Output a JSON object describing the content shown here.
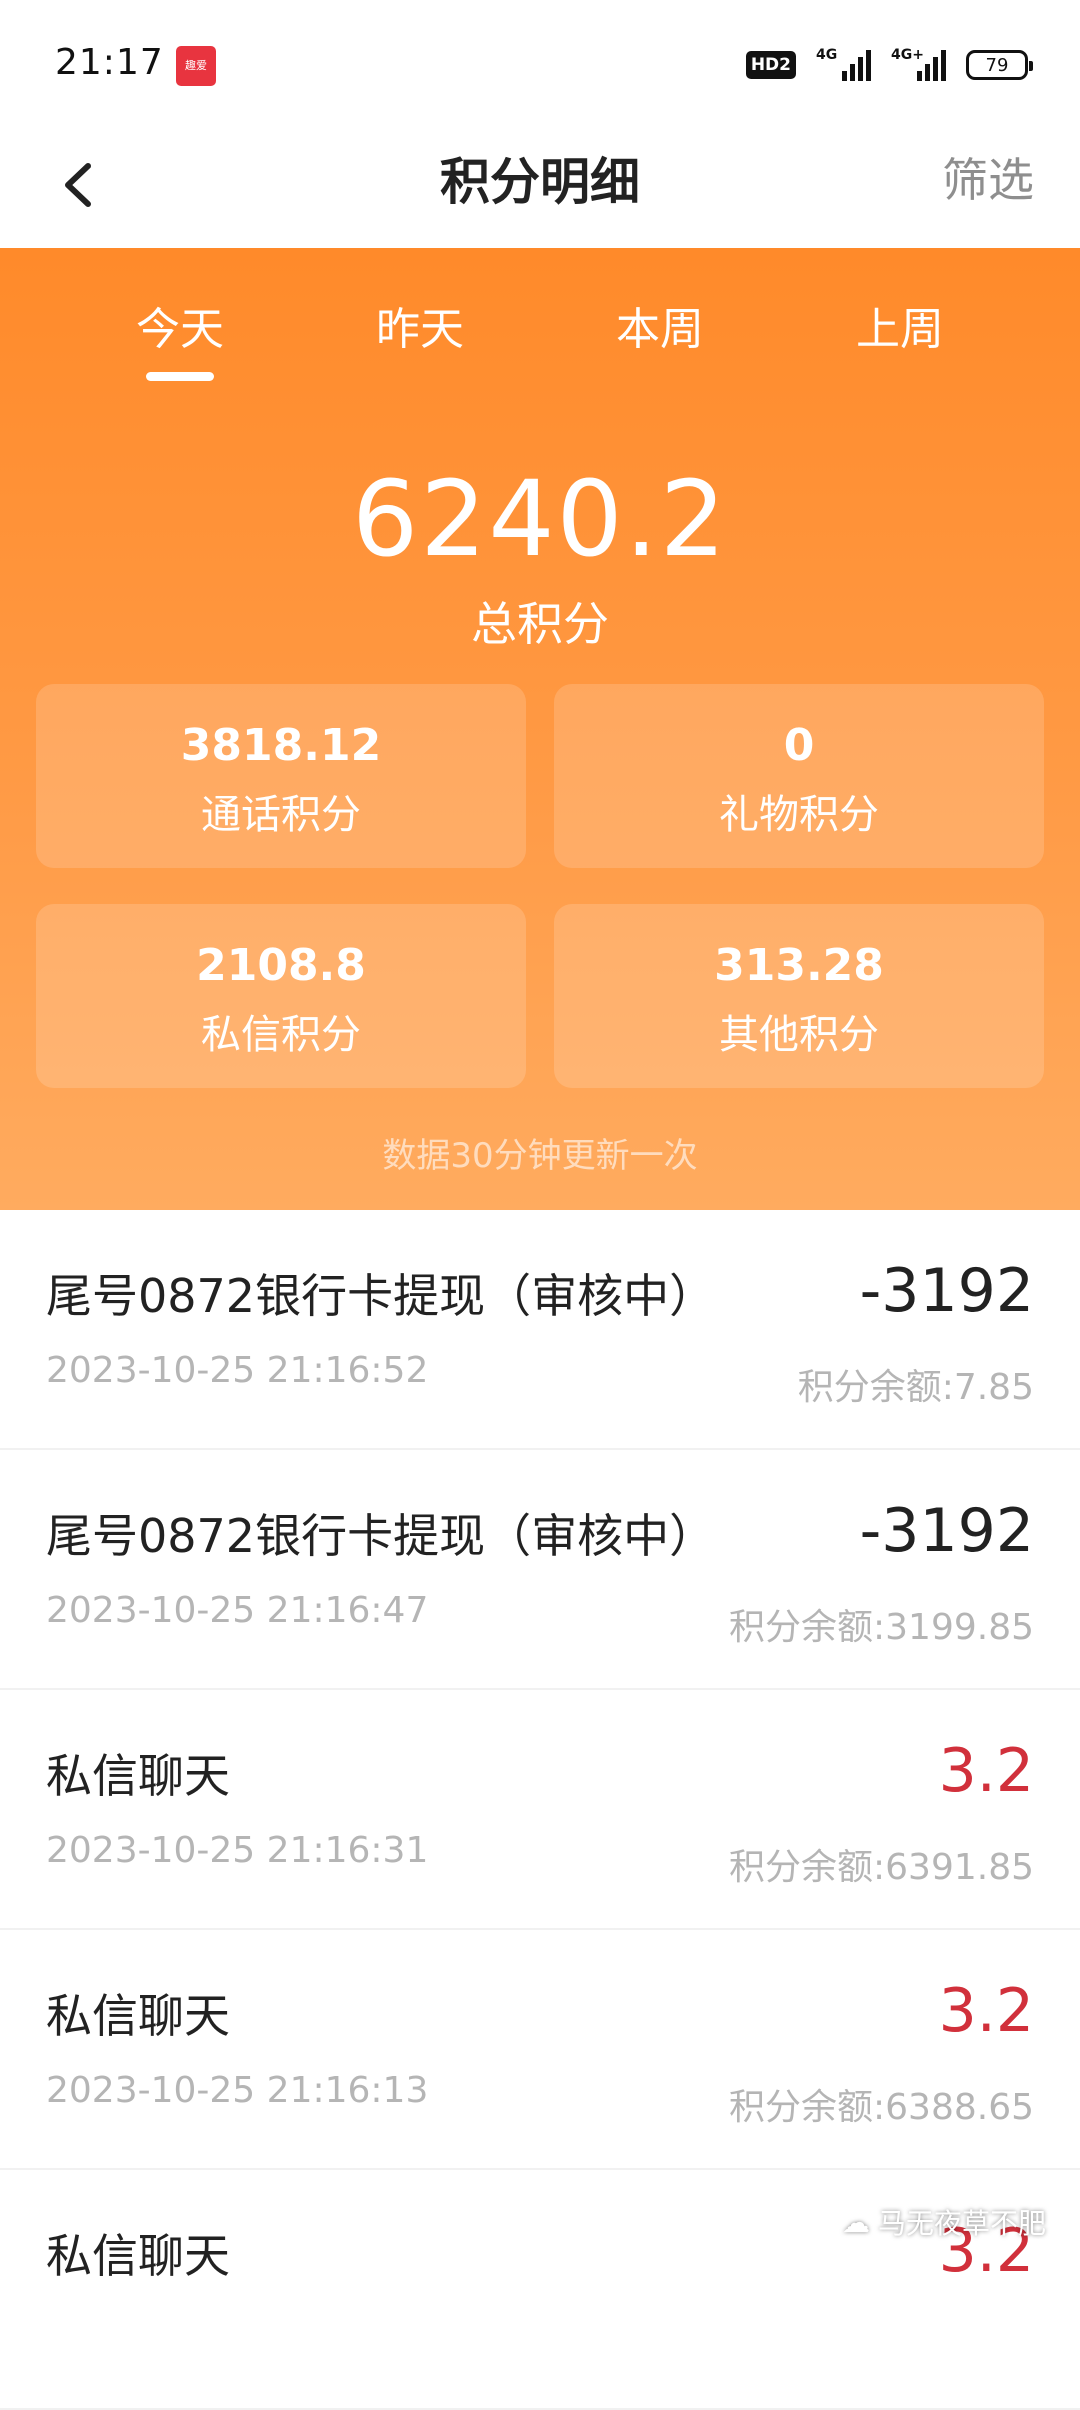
{
  "status_bar": {
    "time": "21:17",
    "app_badge_line1": "趣爱",
    "hd_label": "HD2",
    "signal1_label": "4G",
    "signal2_label": "4G+",
    "battery": "79"
  },
  "nav": {
    "title": "积分明细",
    "filter": "筛选",
    "back_icon": "chevron-left-icon"
  },
  "tabs": [
    "今天",
    "昨天",
    "本周",
    "上周"
  ],
  "active_tab": 0,
  "summary": {
    "total_value": "6240.2",
    "total_label": "总积分",
    "cards": [
      {
        "value": "3818.12",
        "label": "通话积分"
      },
      {
        "value": "0",
        "label": "礼物积分"
      },
      {
        "value": "2108.8",
        "label": "私信积分"
      },
      {
        "value": "313.28",
        "label": "其他积分"
      }
    ],
    "update_note": "数据30分钟更新一次"
  },
  "records": [
    {
      "title": "尾号0872银行卡提现（审核中）",
      "amount": "-3192",
      "positive": false,
      "time": "2023-10-25 21:16:52",
      "balance": "积分余额:7.85"
    },
    {
      "title": "尾号0872银行卡提现（审核中）",
      "amount": "-3192",
      "positive": false,
      "time": "2023-10-25 21:16:47",
      "balance": "积分余额:3199.85"
    },
    {
      "title": "私信聊天",
      "amount": "3.2",
      "positive": true,
      "time": "2023-10-25 21:16:31",
      "balance": "积分余额:6391.85"
    },
    {
      "title": "私信聊天",
      "amount": "3.2",
      "positive": true,
      "time": "2023-10-25 21:16:13",
      "balance": "积分余额:6388.65"
    },
    {
      "title": "私信聊天",
      "amount": "3.2",
      "positive": true,
      "time": "",
      "balance": ""
    }
  ],
  "watermark": "马无夜草不肥",
  "colors": {
    "accent": "#ff8a2a",
    "positive_amount": "#d1303b",
    "muted_text": "#b5b5b5"
  }
}
